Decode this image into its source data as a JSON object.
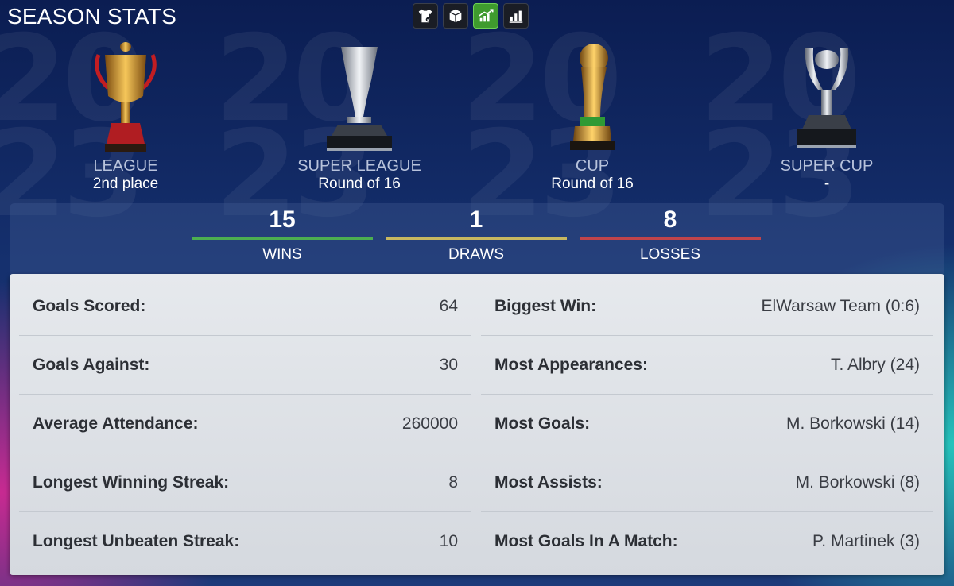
{
  "header": {
    "title": "SEASON STATS"
  },
  "view_tabs": [
    {
      "icon": "jersey-icon"
    },
    {
      "icon": "box-icon"
    },
    {
      "icon": "stats-growth-icon",
      "active": true
    },
    {
      "icon": "bar-chart-icon"
    }
  ],
  "competitions": [
    {
      "name": "LEAGUE",
      "result": "2nd place"
    },
    {
      "name": "SUPER LEAGUE",
      "result": "Round of 16"
    },
    {
      "name": "CUP",
      "result": "Round of 16"
    },
    {
      "name": "SUPER CUP",
      "result": "-"
    }
  ],
  "record": {
    "wins": {
      "value": "15",
      "label": "WINS",
      "color": "#4caf50"
    },
    "draws": {
      "value": "1",
      "label": "DRAWS",
      "color": "#c8b860"
    },
    "losses": {
      "value": "8",
      "label": "LOSSES",
      "color": "#c0444a"
    }
  },
  "stats_left": [
    {
      "label": "Goals Scored:",
      "value": "64"
    },
    {
      "label": "Goals Against:",
      "value": "30"
    },
    {
      "label": "Average Attendance:",
      "value": "260000"
    },
    {
      "label": "Longest Winning Streak:",
      "value": "8"
    },
    {
      "label": "Longest Unbeaten Streak:",
      "value": "10"
    }
  ],
  "stats_right": [
    {
      "label": "Biggest Win:",
      "value": "ElWarsaw Team (0:6)"
    },
    {
      "label": "Most Appearances:",
      "value": "T. Albry (24)"
    },
    {
      "label": "Most Goals:",
      "value": "M. Borkowski (14)"
    },
    {
      "label": "Most Assists:",
      "value": "M. Borkowski (8)"
    },
    {
      "label": "Most Goals In A Match:",
      "value": "P. Martinek (3)"
    }
  ]
}
